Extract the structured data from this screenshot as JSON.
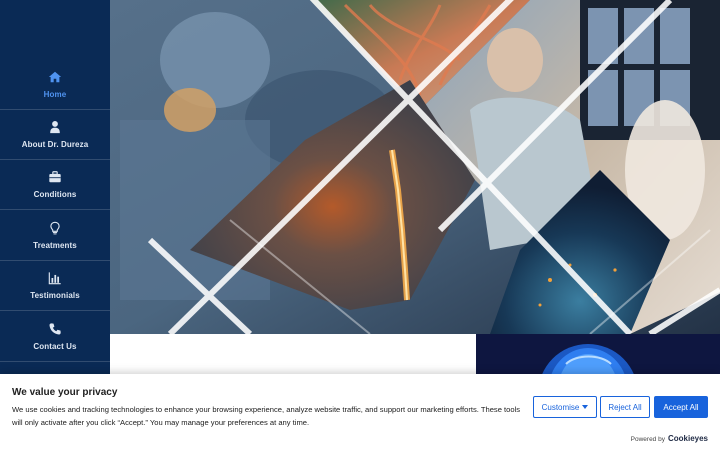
{
  "sidebar": {
    "items": [
      {
        "label": "Home",
        "icon": "home-icon",
        "active": true
      },
      {
        "label": "About Dr. Dureza",
        "icon": "user-icon",
        "active": false
      },
      {
        "label": "Conditions",
        "icon": "briefcase-icon",
        "active": false
      },
      {
        "label": "Treatments",
        "icon": "lightbulb-icon",
        "active": false
      },
      {
        "label": "Testimonials",
        "icon": "bar-chart-icon",
        "active": false
      },
      {
        "label": "Contact Us",
        "icon": "phone-icon",
        "active": false
      }
    ]
  },
  "colors": {
    "sidebar_bg": "#0a2a55",
    "active": "#4f93f0",
    "cookie_accent": "#1863dc"
  },
  "cookie": {
    "title": "We value your privacy",
    "text": "We use cookies and tracking technologies to enhance your browsing experience, analyze website traffic, and support our marketing efforts. These tools will only activate after you click “Accept.” You may manage your preferences at any time.",
    "customise_label": "Customise",
    "reject_label": "Reject All",
    "accept_label": "Accept All",
    "powered_by": "Powered by",
    "brand": "Cookieyes"
  }
}
